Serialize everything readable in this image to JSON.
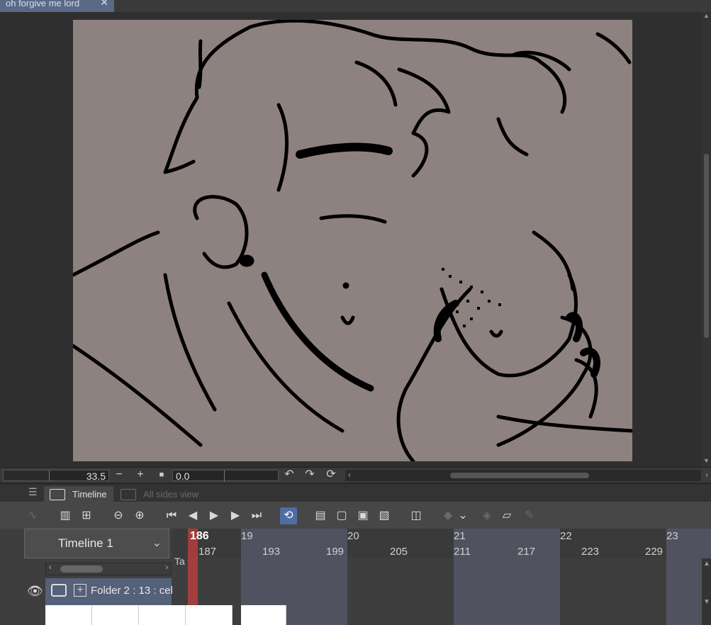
{
  "document": {
    "tab_title": "oh forgive me lord",
    "close_label": "✕"
  },
  "status": {
    "zoom_value": "33.5",
    "zoom_minus": "−",
    "zoom_plus": "+",
    "zoom_fit": "■",
    "rotation_value": "0.0",
    "undo_icon": "↶",
    "redo_icon": "↷",
    "reset_icon": "⟳"
  },
  "panel": {
    "menu_icon": "☰",
    "tabs": [
      {
        "label": "Timeline",
        "active": true
      },
      {
        "label": "All sides view",
        "active": false
      }
    ]
  },
  "toolbar": {
    "buttons": [
      "graph-icon",
      "new-timeline-icon",
      "add-cell-icon",
      "zoom-out-icon",
      "zoom-in-icon",
      "first-frame-icon",
      "prev-frame-icon",
      "play-icon",
      "next-frame-icon",
      "last-frame-icon",
      "loop-icon",
      "new-animation-folder-icon",
      "new-cel-icon",
      "specify-cel-icon",
      "delete-cel-icon",
      "onion-skin-icon",
      "keyframe-icon",
      "keyframe-menu-icon",
      "clear-keyframe-icon",
      "erase-icon",
      "edit-icon"
    ]
  },
  "timeline": {
    "name": "Timeline 1",
    "current_frame": "186",
    "frame_after": "187",
    "seconds": [
      "19",
      "20",
      "21",
      "22",
      "23"
    ],
    "frames": [
      "193",
      "199",
      "205",
      "211",
      "217",
      "223",
      "229"
    ],
    "ta_label": "Ta",
    "layer_name": "Folder 2 : 13 : cel"
  },
  "colors": {
    "canvas": "#8e8280",
    "accent": "#4c6ea3",
    "playhead": "#b53e3e",
    "tab_active": "#5a6a86"
  }
}
